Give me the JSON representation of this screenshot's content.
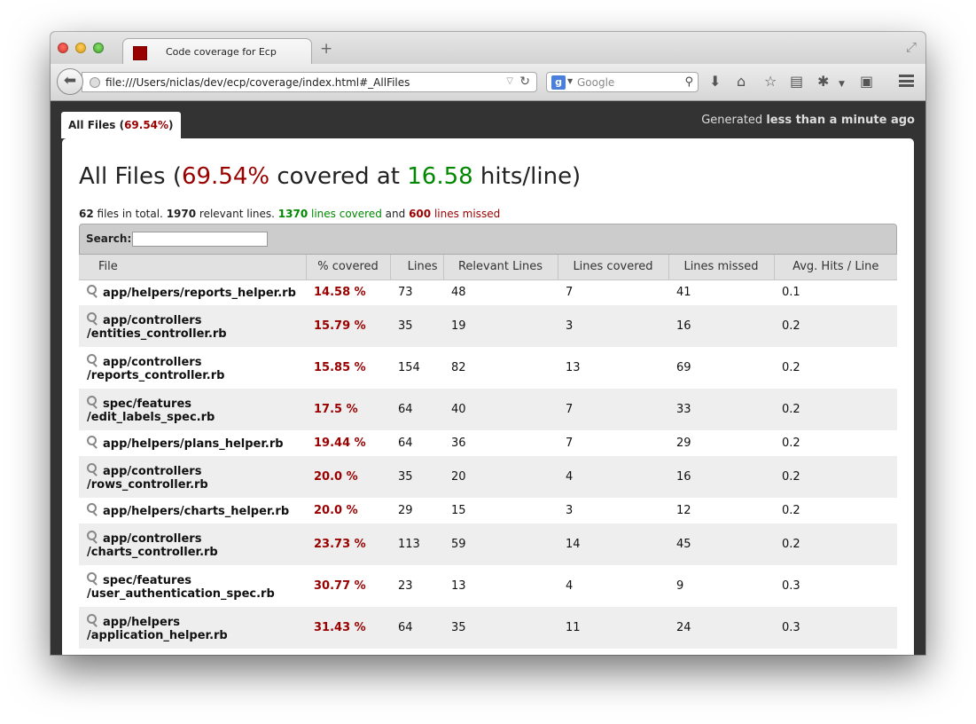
{
  "browser": {
    "tab_title": "Code coverage for Ecp",
    "url": "file:///Users/niclas/dev/ecp/coverage/index.html#_AllFiles",
    "search_placeholder": "Google",
    "search_engine_letter": "g"
  },
  "report": {
    "tab_label": "All Files (",
    "tab_pct": "69.54%",
    "tab_label_end": ")",
    "generated_prefix": "Generated ",
    "generated_when": "less than a minute ago",
    "heading": {
      "prefix": "All Files (",
      "pct": "69.54%",
      "mid": " covered at ",
      "hits": "16.58",
      "suffix": " hits/line)"
    },
    "summary": {
      "files": "62",
      "files_text": " files in total. ",
      "relevant": "1970",
      "relevant_text": " relevant lines. ",
      "covered": "1370",
      "covered_text": " lines covered",
      "and_text": " and ",
      "missed": "600",
      "missed_text": " lines missed"
    },
    "search_label": "Search:",
    "search_value": "",
    "columns": [
      "File",
      "% covered",
      "Lines",
      "Relevant Lines",
      "Lines covered",
      "Lines missed",
      "Avg. Hits / Line"
    ],
    "rows": [
      {
        "file": [
          "app/helpers/reports_helper.rb"
        ],
        "pct": "14.58 %",
        "lines": "73",
        "relevant": "48",
        "covered": "7",
        "missed": "41",
        "avg": "0.1"
      },
      {
        "file": [
          "app/controllers",
          "/entities_controller.rb"
        ],
        "pct": "15.79 %",
        "lines": "35",
        "relevant": "19",
        "covered": "3",
        "missed": "16",
        "avg": "0.2"
      },
      {
        "file": [
          "app/controllers",
          "/reports_controller.rb"
        ],
        "pct": "15.85 %",
        "lines": "154",
        "relevant": "82",
        "covered": "13",
        "missed": "69",
        "avg": "0.2"
      },
      {
        "file": [
          "spec/features",
          "/edit_labels_spec.rb"
        ],
        "pct": "17.5 %",
        "lines": "64",
        "relevant": "40",
        "covered": "7",
        "missed": "33",
        "avg": "0.2"
      },
      {
        "file": [
          "app/helpers/plans_helper.rb"
        ],
        "pct": "19.44 %",
        "lines": "64",
        "relevant": "36",
        "covered": "7",
        "missed": "29",
        "avg": "0.2"
      },
      {
        "file": [
          "app/controllers",
          "/rows_controller.rb"
        ],
        "pct": "20.0 %",
        "lines": "35",
        "relevant": "20",
        "covered": "4",
        "missed": "16",
        "avg": "0.2"
      },
      {
        "file": [
          "app/helpers/charts_helper.rb"
        ],
        "pct": "20.0 %",
        "lines": "29",
        "relevant": "15",
        "covered": "3",
        "missed": "12",
        "avg": "0.2"
      },
      {
        "file": [
          "app/controllers",
          "/charts_controller.rb"
        ],
        "pct": "23.73 %",
        "lines": "113",
        "relevant": "59",
        "covered": "14",
        "missed": "45",
        "avg": "0.2"
      },
      {
        "file": [
          "spec/features",
          "/user_authentication_spec.rb"
        ],
        "pct": "30.77 %",
        "lines": "23",
        "relevant": "13",
        "covered": "4",
        "missed": "9",
        "avg": "0.3"
      },
      {
        "file": [
          "app/helpers",
          "/application_helper.rb"
        ],
        "pct": "31.43 %",
        "lines": "64",
        "relevant": "35",
        "covered": "11",
        "missed": "24",
        "avg": "0.3"
      }
    ]
  },
  "colors": {
    "missed_red": "#990000",
    "covered_green": "#008800",
    "chrome_dark": "#333333"
  }
}
